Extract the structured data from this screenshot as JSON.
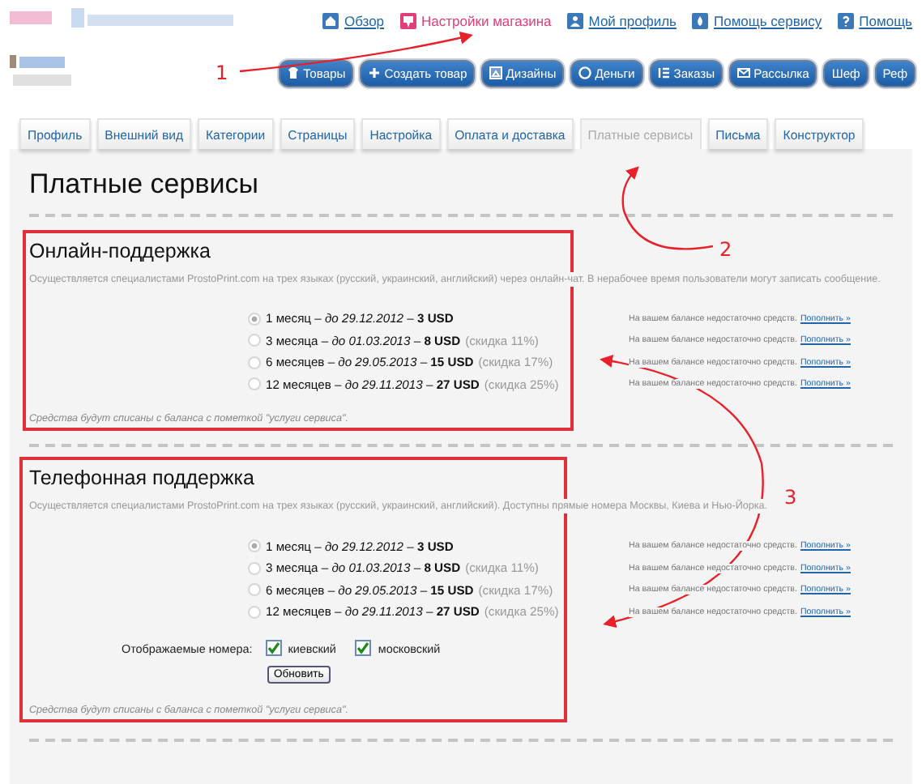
{
  "top_links": [
    {
      "label": "Обзор",
      "selected": false
    },
    {
      "label": "Настройки магазина",
      "selected": true
    },
    {
      "label": "Мой профиль",
      "selected": false
    },
    {
      "label": "Помощь сервису",
      "selected": false
    },
    {
      "label": "Помощь",
      "selected": false
    }
  ],
  "nav_buttons": [
    {
      "label": "Товары"
    },
    {
      "label": "Создать товар"
    },
    {
      "label": "Дизайны"
    },
    {
      "label": "Деньги"
    },
    {
      "label": "Заказы"
    },
    {
      "label": "Рассылка"
    },
    {
      "label": "Шеф"
    },
    {
      "label": "Реф"
    }
  ],
  "tabs": [
    {
      "label": "Профиль",
      "selected": false
    },
    {
      "label": "Внешний вид",
      "selected": false
    },
    {
      "label": "Категории",
      "selected": false
    },
    {
      "label": "Страницы",
      "selected": false
    },
    {
      "label": "Настройка",
      "selected": false
    },
    {
      "label": "Оплата и доставка",
      "selected": false
    },
    {
      "label": "Платные сервисы",
      "selected": true
    },
    {
      "label": "Письма",
      "selected": false
    },
    {
      "label": "Конструктор",
      "selected": false
    }
  ],
  "page_title": "Платные сервисы",
  "sections": [
    {
      "title": "Онлайн-поддержка",
      "description": "Осуществляется специалистами ProstoPrint.com на трех языках (русский, украинский, английский) через онлайн-чат. В нерабочее время пользователи могут записать сообщение.",
      "options": [
        {
          "label": "1 месяц – *до 29.12.2012* – **3 USD**",
          "selected": true,
          "note": "На вашем балансе недостаточно средств.",
          "link": "Пополнить »"
        },
        {
          "label": "3 месяца – *до 01.03.2013* – **8 USD**",
          "discount": "(скидка 11%)",
          "selected": false,
          "note": "На вашем балансе недостаточно средств.",
          "link": "Пополнить »"
        },
        {
          "label": "6 месяцев – *до 29.05.2013* – **15 USD**",
          "discount": "(скидка 17%)",
          "selected": false,
          "note": "На вашем балансе недостаточно средств.",
          "link": "Пополнить »"
        },
        {
          "label": "12 месяцев – *до 29.11.2013* – **27 USD**",
          "discount": "(скидка 25%)",
          "selected": false,
          "note": "На вашем балансе недостаточно средств.",
          "link": "Пополнить »"
        }
      ],
      "footer": "Средства будут списаны с баланса с пометкой \"услуги сервиса\"."
    },
    {
      "title": "Телефонная поддержка",
      "description": "Осуществляется специалистами ProstoPrint.com на трех языках (русский, украинский, английский). Доступны прямые номера Москвы, Киева и Нью-Йорка.",
      "options": [
        {
          "label": "1 месяц – *до 29.12.2012* – **3 USD**",
          "selected": true,
          "note": "На вашем балансе недостаточно средств.",
          "link": "Пополнить »"
        },
        {
          "label": "3 месяца – *до 01.03.2013* – **8 USD**",
          "discount": "(скидка 11%)",
          "selected": false,
          "note": "На вашем балансе недостаточно средств.",
          "link": "Пополнить »"
        },
        {
          "label": "6 месяцев – *до 29.05.2013* – **15 USD**",
          "discount": "(скидка 17%)",
          "selected": false,
          "note": "На вашем балансе недостаточно средств.",
          "link": "Пополнить »"
        },
        {
          "label": "12 месяцев – *до 29.11.2013* – **27 USD**",
          "discount": "(скидка 25%)",
          "selected": false,
          "note": "На вашем балансе недостаточно средств.",
          "link": "Пополнить »"
        }
      ],
      "numbers": {
        "label": "Отображаемые номера:",
        "choices": [
          {
            "label": "киевский",
            "checked": true
          },
          {
            "label": "московский",
            "checked": true
          }
        ],
        "button": "Обновить"
      },
      "footer": "Средства будут списаны с баланса с пометкой \"услуги сервиса\"."
    }
  ],
  "annotations": [
    {
      "label": "1"
    },
    {
      "label": "2"
    },
    {
      "label": "3"
    }
  ]
}
